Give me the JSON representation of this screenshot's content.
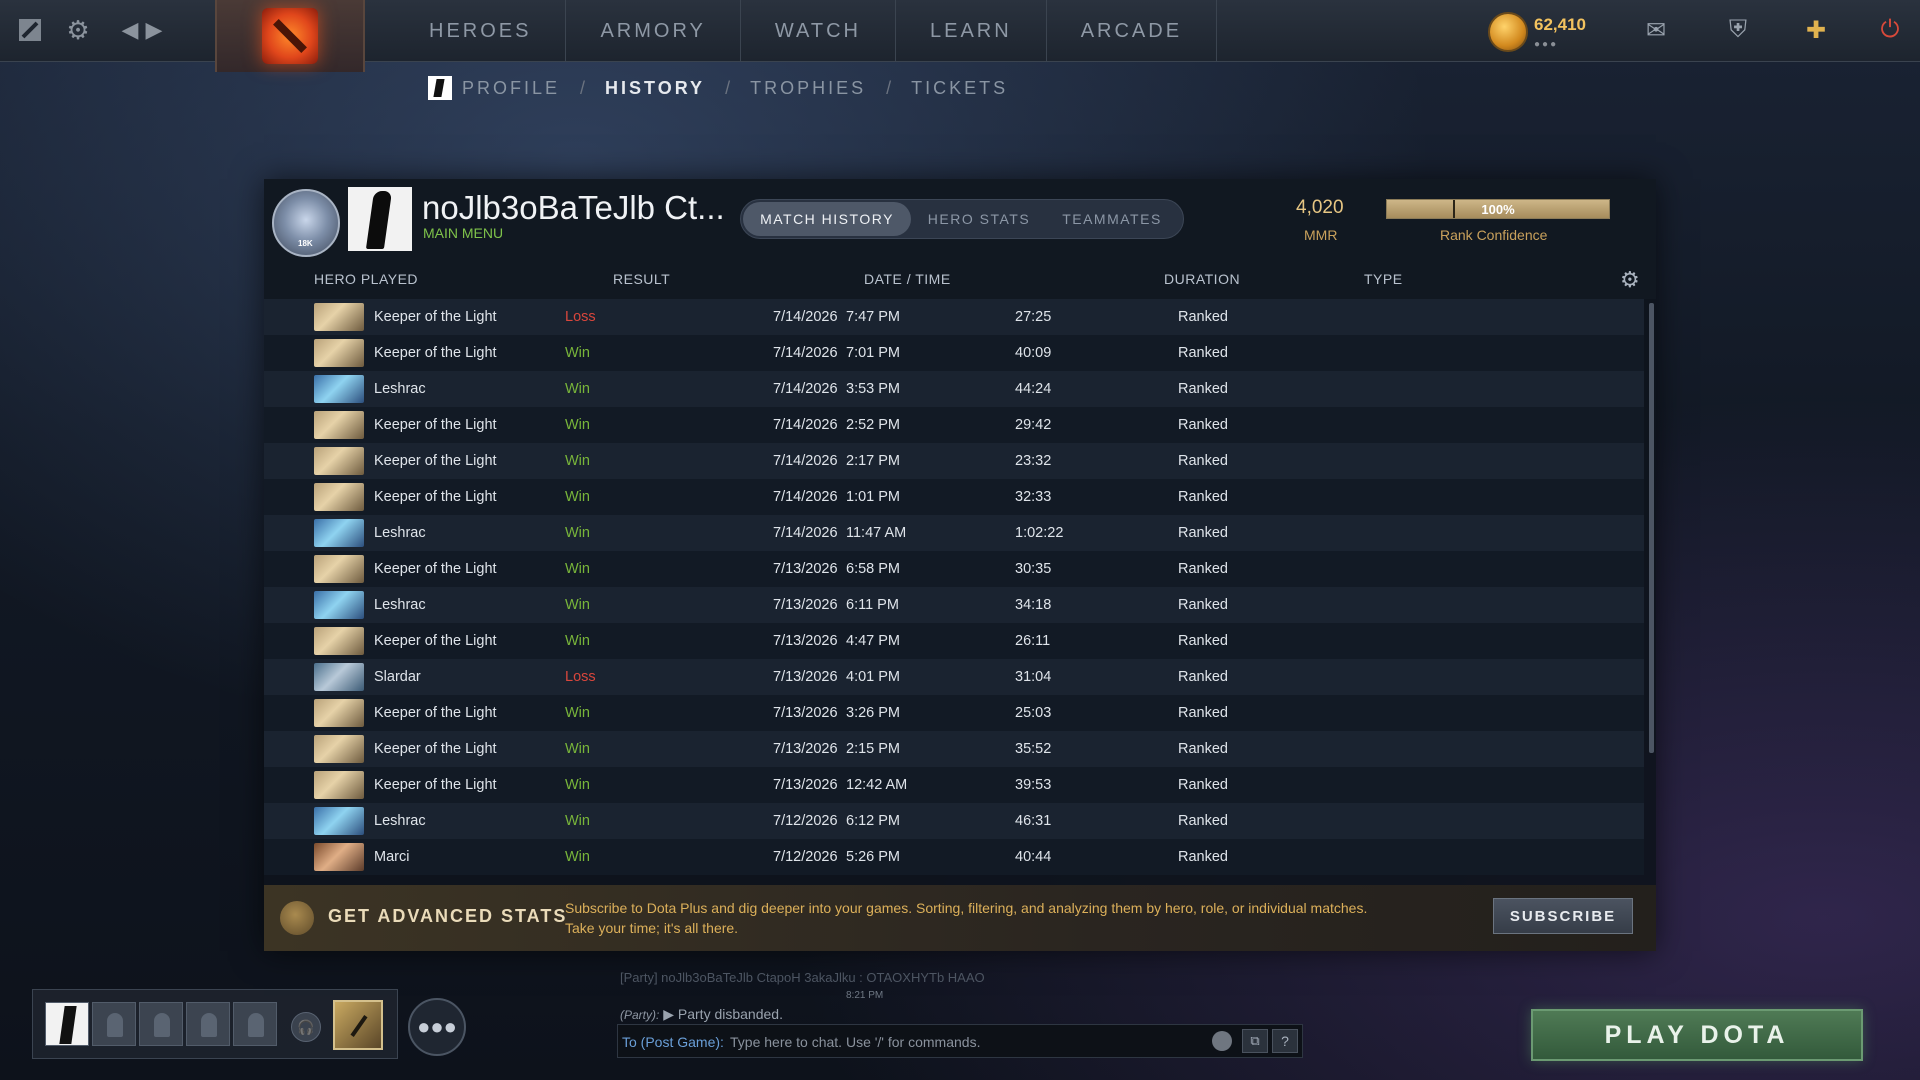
{
  "top_nav": {
    "items": [
      "HEROES",
      "ARMORY",
      "WATCH",
      "LEARN",
      "ARCADE"
    ],
    "currency_value": "62,410"
  },
  "sub_nav": {
    "profile": "PROFILE",
    "history": "HISTORY",
    "trophies": "TROPHIES",
    "tickets": "TICKETS",
    "separator": "/"
  },
  "profile": {
    "name": "noJlb3oBaTeJlb Ct...",
    "status": "MAIN MENU",
    "medal_rank": "18K",
    "mmr_value": "4,020",
    "mmr_label": "MMR",
    "rank_confidence_value": "100%",
    "rank_confidence_fraction": 1.0,
    "rank_confidence_label": "Rank Confidence"
  },
  "tabs": {
    "match_history": "MATCH HISTORY",
    "hero_stats": "HERO STATS",
    "teammates": "TEAMMATES"
  },
  "table": {
    "headers": {
      "hero": "HERO PLAYED",
      "result": "RESULT",
      "datetime": "DATE / TIME",
      "duration": "DURATION",
      "type": "TYPE"
    },
    "rows": [
      {
        "hero": "Keeper of the Light",
        "hero_icon": "kotl",
        "result": "Loss",
        "date": "7/14/2026",
        "time": "7:47 PM",
        "duration": "27:25",
        "type": "Ranked"
      },
      {
        "hero": "Keeper of the Light",
        "hero_icon": "kotl",
        "result": "Win",
        "date": "7/14/2026",
        "time": "7:01 PM",
        "duration": "40:09",
        "type": "Ranked"
      },
      {
        "hero": "Leshrac",
        "hero_icon": "leshrac",
        "result": "Win",
        "date": "7/14/2026",
        "time": "3:53 PM",
        "duration": "44:24",
        "type": "Ranked"
      },
      {
        "hero": "Keeper of the Light",
        "hero_icon": "kotl",
        "result": "Win",
        "date": "7/14/2026",
        "time": "2:52 PM",
        "duration": "29:42",
        "type": "Ranked"
      },
      {
        "hero": "Keeper of the Light",
        "hero_icon": "kotl",
        "result": "Win",
        "date": "7/14/2026",
        "time": "2:17 PM",
        "duration": "23:32",
        "type": "Ranked"
      },
      {
        "hero": "Keeper of the Light",
        "hero_icon": "kotl",
        "result": "Win",
        "date": "7/14/2026",
        "time": "1:01 PM",
        "duration": "32:33",
        "type": "Ranked"
      },
      {
        "hero": "Leshrac",
        "hero_icon": "leshrac",
        "result": "Win",
        "date": "7/14/2026",
        "time": "11:47 AM",
        "duration": "1:02:22",
        "type": "Ranked"
      },
      {
        "hero": "Keeper of the Light",
        "hero_icon": "kotl",
        "result": "Win",
        "date": "7/13/2026",
        "time": "6:58 PM",
        "duration": "30:35",
        "type": "Ranked"
      },
      {
        "hero": "Leshrac",
        "hero_icon": "leshrac",
        "result": "Win",
        "date": "7/13/2026",
        "time": "6:11 PM",
        "duration": "34:18",
        "type": "Ranked"
      },
      {
        "hero": "Keeper of the Light",
        "hero_icon": "kotl",
        "result": "Win",
        "date": "7/13/2026",
        "time": "4:47 PM",
        "duration": "26:11",
        "type": "Ranked"
      },
      {
        "hero": "Slardar",
        "hero_icon": "slardar",
        "result": "Loss",
        "date": "7/13/2026",
        "time": "4:01 PM",
        "duration": "31:04",
        "type": "Ranked"
      },
      {
        "hero": "Keeper of the Light",
        "hero_icon": "kotl",
        "result": "Win",
        "date": "7/13/2026",
        "time": "3:26 PM",
        "duration": "25:03",
        "type": "Ranked"
      },
      {
        "hero": "Keeper of the Light",
        "hero_icon": "kotl",
        "result": "Win",
        "date": "7/13/2026",
        "time": "2:15 PM",
        "duration": "35:52",
        "type": "Ranked"
      },
      {
        "hero": "Keeper of the Light",
        "hero_icon": "kotl",
        "result": "Win",
        "date": "7/13/2026",
        "time": "12:42 AM",
        "duration": "39:53",
        "type": "Ranked"
      },
      {
        "hero": "Leshrac",
        "hero_icon": "leshrac",
        "result": "Win",
        "date": "7/12/2026",
        "time": "6:12 PM",
        "duration": "46:31",
        "type": "Ranked"
      },
      {
        "hero": "Marci",
        "hero_icon": "marci",
        "result": "Win",
        "date": "7/12/2026",
        "time": "5:26 PM",
        "duration": "40:44",
        "type": "Ranked"
      }
    ]
  },
  "banner": {
    "title": "GET ADVANCED STATS",
    "text": "Subscribe to Dota Plus and dig deeper into your games. Sorting, filtering, and analyzing them by hero, role, or individual matches. Take your time; it's all there.",
    "button": "SUBSCRIBE"
  },
  "chat": {
    "faded_line": "[Party] noJlb3oBaTeJlb CtapoH  3akaJlku : OTAOXHYTb HAAO",
    "timestamp": "8:21 PM",
    "party_channel": "(Party):",
    "party_message": "Party disbanded.",
    "to_label": "To (Post Game):",
    "placeholder": "Type here to chat. Use '/' for commands.",
    "help": "?"
  },
  "play_button": "PLAY DOTA",
  "colors": {
    "win": "#78b53a",
    "loss": "#d9463c",
    "gold": "#dcb05a",
    "play": "#335a3b"
  }
}
